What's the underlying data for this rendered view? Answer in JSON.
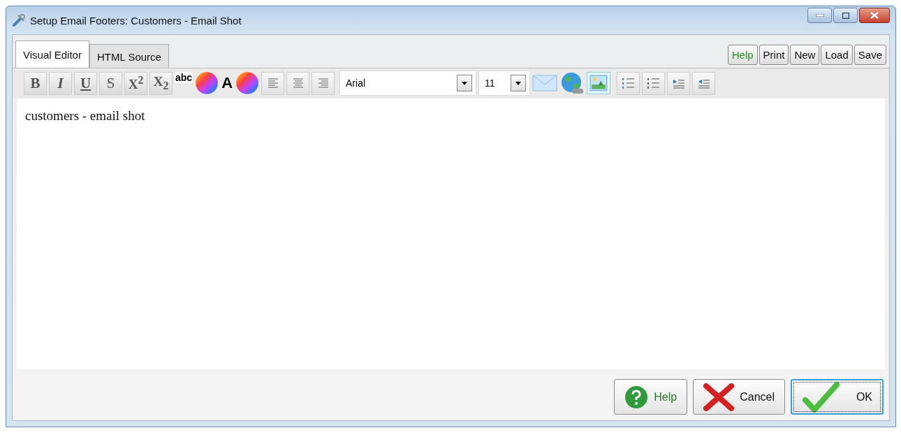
{
  "window": {
    "title": "Setup Email Footers:  Customers - Email Shot"
  },
  "tabs": [
    {
      "label": "Visual Editor",
      "selected": true
    },
    {
      "label": "HTML Source",
      "selected": false
    }
  ],
  "top_buttons": [
    {
      "label": "Help",
      "kind": "help"
    },
    {
      "label": "Print",
      "kind": "normal"
    },
    {
      "label": "New",
      "kind": "normal"
    },
    {
      "label": "Load",
      "kind": "normal"
    },
    {
      "label": "Save",
      "kind": "normal"
    }
  ],
  "format_buttons": [
    {
      "label": "B",
      "kind": "bold"
    },
    {
      "label": "I",
      "kind": "italic"
    },
    {
      "label": "U",
      "kind": "underline"
    },
    {
      "label": "S",
      "kind": "strike"
    },
    {
      "label": "X$^{2}$",
      "kind": "plain"
    },
    {
      "label": "X$_{2}$",
      "kind": "plain"
    }
  ],
  "color_pickers": [
    {
      "label": "abc",
      "kind": "highlight"
    },
    {
      "label": "A",
      "kind": "text"
    }
  ],
  "font": {
    "value": "Arial"
  },
  "size": {
    "value": "11"
  },
  "editor": {
    "text": "customers - email shot"
  },
  "bottom_buttons": [
    {
      "label": "Help",
      "kind": "help",
      "focused": false
    },
    {
      "label": "Cancel",
      "kind": "cancel",
      "focused": false
    },
    {
      "label": "OK",
      "kind": "ok",
      "focused": true
    }
  ]
}
